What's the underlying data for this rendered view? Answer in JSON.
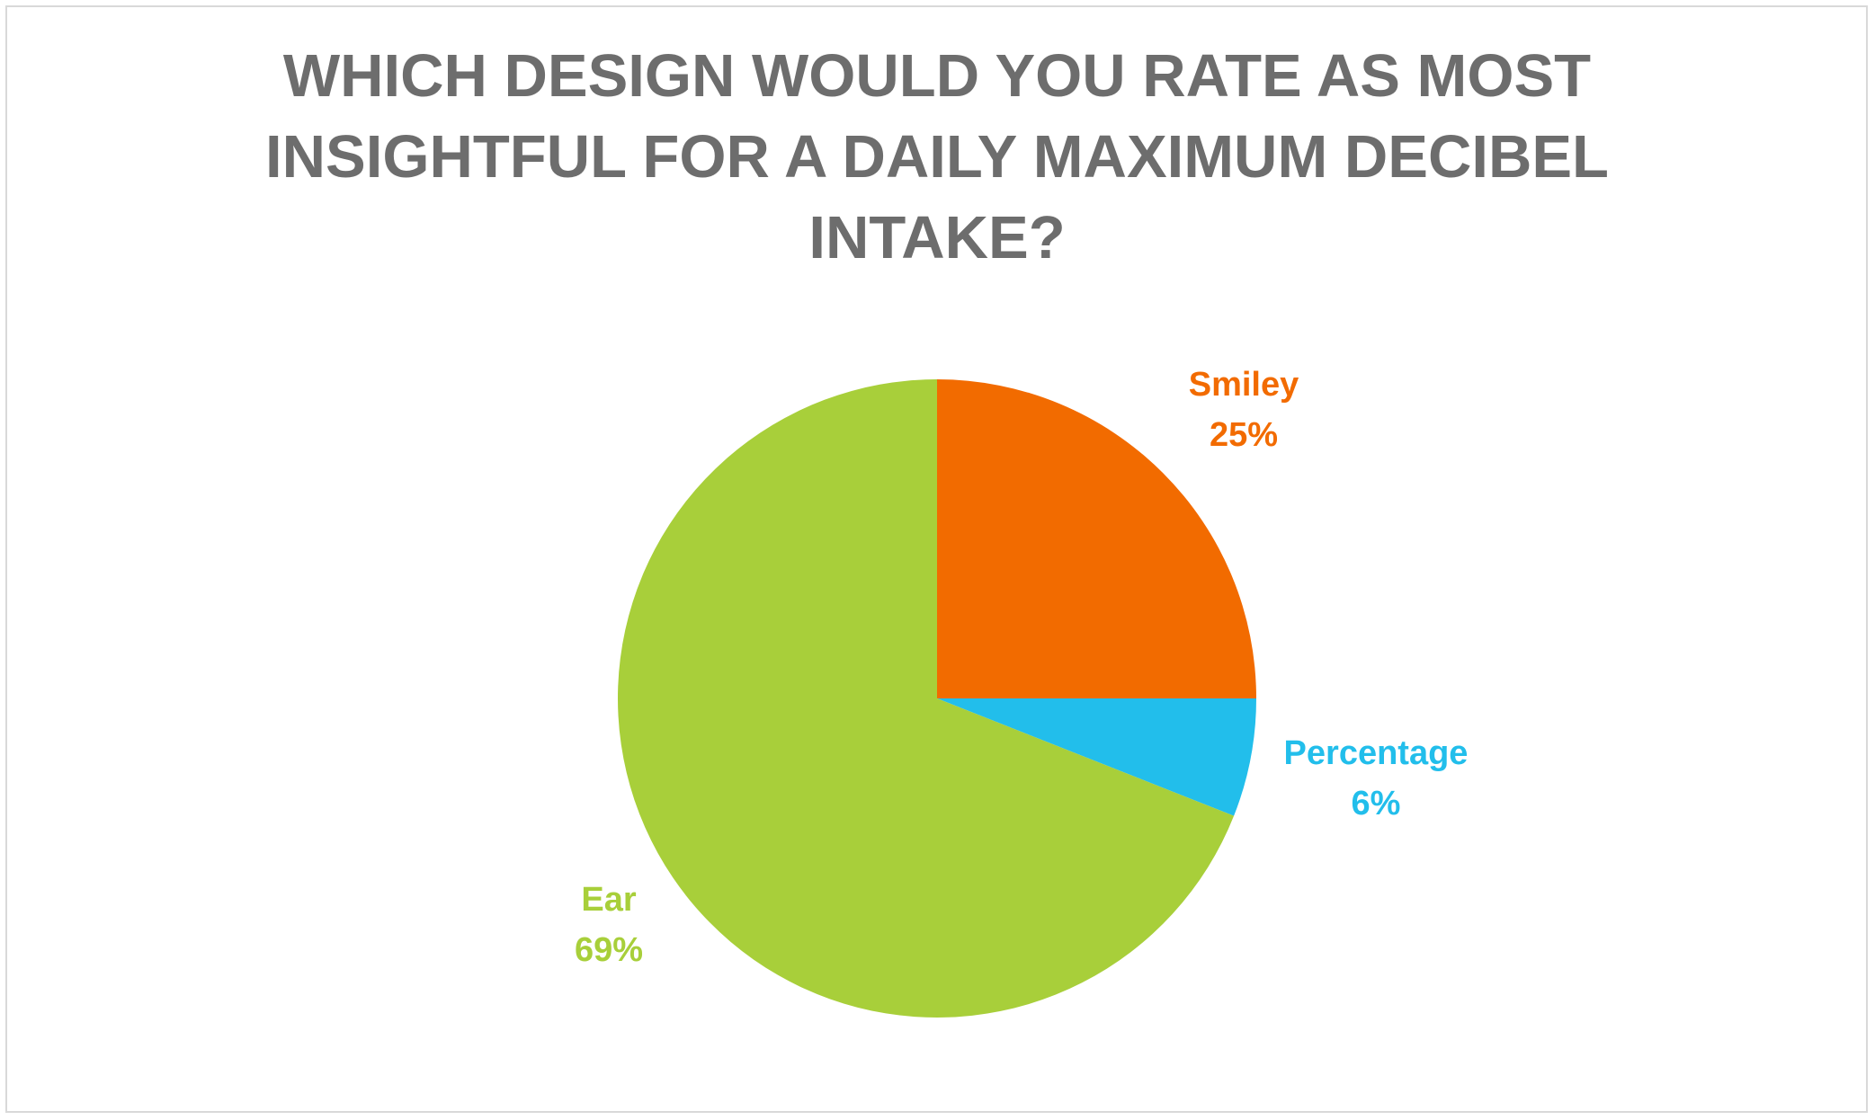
{
  "chart_data": {
    "type": "pie",
    "title": "WHICH DESIGN WOULD YOU RATE AS MOST INSIGHTFUL FOR A DAILY MAXIMUM DECIBEL INTAKE?",
    "title_lines": [
      "WHICH DESIGN WOULD YOU RATE AS MOST",
      "INSIGHTFUL FOR A DAILY MAXIMUM DECIBEL",
      "INTAKE?"
    ],
    "slices": [
      {
        "label": "Smiley",
        "value": 25,
        "value_label": "25%",
        "color": "#F26B00"
      },
      {
        "label": "Percentage",
        "value": 6,
        "value_label": "6%",
        "color": "#22BEEB"
      },
      {
        "label": "Ear",
        "value": 69,
        "value_label": "69%",
        "color": "#A8CF3A"
      }
    ],
    "start_angle": "12 o'clock",
    "direction": "clockwise",
    "legend": "none",
    "data_labels": "outside, category name and percentage"
  },
  "colors": {
    "title": "#6D6D6D",
    "frame_border": "#D9D9D9",
    "background": "#FFFFFF"
  }
}
